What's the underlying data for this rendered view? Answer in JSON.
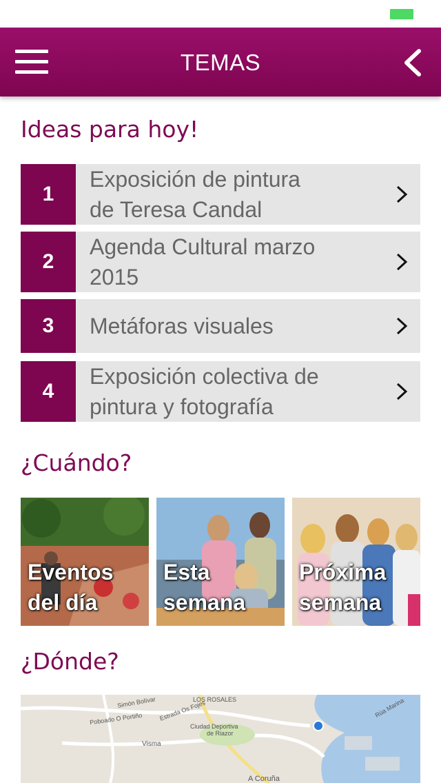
{
  "header": {
    "title": "TEMAS"
  },
  "ideas": {
    "heading": "Ideas para hoy!",
    "items": [
      {
        "number": "1",
        "line1": "Exposición de pintura",
        "line2": "de Teresa Candal"
      },
      {
        "number": "2",
        "line1": "Agenda Cultural marzo",
        "line2": "2015"
      },
      {
        "number": "3",
        "line1": "Metáforas visuales",
        "line2": ""
      },
      {
        "number": "4",
        "line1": "Exposición colectiva de",
        "line2": "pintura y fotografía"
      }
    ]
  },
  "when": {
    "heading": "¿Cuándo?",
    "tiles": [
      {
        "line1": "Eventos",
        "line2": "del día"
      },
      {
        "line1": "Esta",
        "line2": "semana"
      },
      {
        "line1": "Próxima",
        "line2": "semana"
      }
    ]
  },
  "where": {
    "heading": "¿Dónde?",
    "map_labels": {
      "rosales": "LOS ROSALES",
      "ciudad_deportiva": "Ciudad Deportiva",
      "riazor": "de Riazor",
      "visma": "Visma",
      "coruna": "A Coruña",
      "simon_bolivar": "Simón Bolívar",
      "poboado": "Poboado O Portiño",
      "estrada": "Estrada Os Fojes",
      "rua": "Rúa Marina"
    }
  },
  "colors": {
    "brand": "#7e0550",
    "heading": "#7e0a54",
    "item_bg": "#e5e5e5",
    "battery": "#4cd964"
  }
}
